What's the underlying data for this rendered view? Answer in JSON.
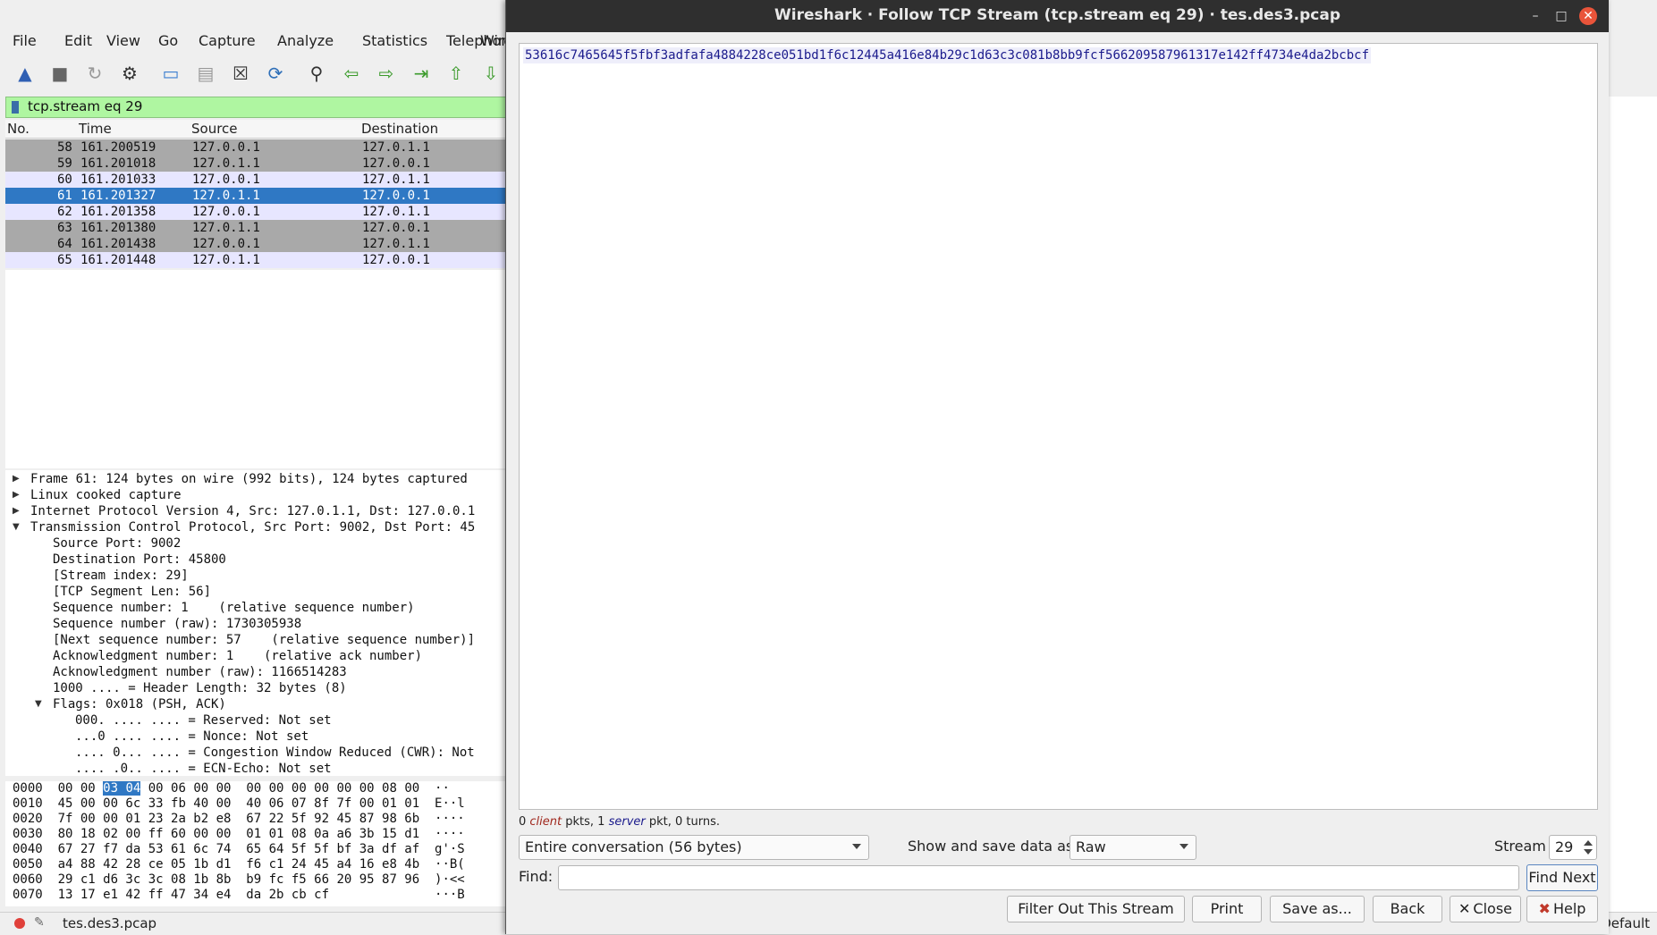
{
  "main": {
    "menu": [
      "File",
      "Edit",
      "View",
      "Go",
      "Capture",
      "Analyze",
      "Statistics",
      "Telephony",
      "Wirele"
    ],
    "filter": "tcp.stream eq 29",
    "columns": [
      "No.",
      "Time",
      "Source",
      "Destination"
    ],
    "packets": [
      {
        "no": "58",
        "time": "161.200519",
        "src": "127.0.0.1",
        "dst": "127.0.1.1"
      },
      {
        "no": "59",
        "time": "161.201018",
        "src": "127.0.1.1",
        "dst": "127.0.0.1"
      },
      {
        "no": "60",
        "time": "161.201033",
        "src": "127.0.0.1",
        "dst": "127.0.1.1"
      },
      {
        "no": "61",
        "time": "161.201327",
        "src": "127.0.1.1",
        "dst": "127.0.0.1"
      },
      {
        "no": "62",
        "time": "161.201358",
        "src": "127.0.0.1",
        "dst": "127.0.1.1"
      },
      {
        "no": "63",
        "time": "161.201380",
        "src": "127.0.1.1",
        "dst": "127.0.0.1"
      },
      {
        "no": "64",
        "time": "161.201438",
        "src": "127.0.0.1",
        "dst": "127.0.1.1"
      },
      {
        "no": "65",
        "time": "161.201448",
        "src": "127.0.1.1",
        "dst": "127.0.0.1"
      }
    ],
    "details": [
      "Frame 61: 124 bytes on wire (992 bits), 124 bytes captured",
      "Linux cooked capture",
      "Internet Protocol Version 4, Src: 127.0.1.1, Dst: 127.0.0.1",
      "Transmission Control Protocol, Src Port: 9002, Dst Port: 45",
      "Source Port: 9002",
      "Destination Port: 45800",
      "[Stream index: 29]",
      "[TCP Segment Len: 56]",
      "Sequence number: 1    (relative sequence number)",
      "Sequence number (raw): 1730305938",
      "[Next sequence number: 57    (relative sequence number)]",
      "Acknowledgment number: 1    (relative ack number)",
      "Acknowledgment number (raw): 1166514283",
      "1000 .... = Header Length: 32 bytes (8)",
      "Flags: 0x018 (PSH, ACK)",
      "000. .... .... = Reserved: Not set",
      "...0 .... .... = Nonce: Not set",
      ".... 0... .... = Congestion Window Reduced (CWR): Not",
      ".... .0.. .... = ECN-Echo: Not set"
    ],
    "bytes": [
      {
        "off": "0000",
        "pre": "00 00 ",
        "hl": "03 04",
        "post": " 00 06 00 00  00 00 00 00 00 00 08 00",
        "ascii": "  ··"
      },
      {
        "off": "0010",
        "pre": "45 00 00 6c 33 fb 40 00  40 06 07 8f 7f 00 01 01",
        "hl": "",
        "post": "",
        "ascii": "  E··l"
      },
      {
        "off": "0020",
        "pre": "7f 00 00 01 23 2a b2 e8  67 22 5f 92 45 87 98 6b",
        "hl": "",
        "post": "",
        "ascii": "  ····"
      },
      {
        "off": "0030",
        "pre": "80 18 02 00 ff 60 00 00  01 01 08 0a a6 3b 15 d1",
        "hl": "",
        "post": "",
        "ascii": "  ····"
      },
      {
        "off": "0040",
        "pre": "67 27 f7 da 53 61 6c 74  65 64 5f 5f bf 3a df af",
        "hl": "",
        "post": "",
        "ascii": "  g'·S"
      },
      {
        "off": "0050",
        "pre": "a4 88 42 28 ce 05 1b d1  f6 c1 24 45 a4 16 e8 4b",
        "hl": "",
        "post": "",
        "ascii": "  ··B("
      },
      {
        "off": "0060",
        "pre": "29 c1 d6 3c 3c 08 1b 8b  b9 fc f5 66 20 95 87 96",
        "hl": "",
        "post": "",
        "ascii": "  )·<<"
      },
      {
        "off": "0070",
        "pre": "13 17 e1 42 ff 47 34 e4  da 2b cb cf",
        "hl": "",
        "post": "",
        "ascii": "              ···B"
      }
    ],
    "status_file": "tes.des3.pcap",
    "status_profile": "Default"
  },
  "dialog": {
    "title": "Wireshark · Follow TCP Stream (tcp.stream eq 29) · tes.des3.pcap",
    "stream_text": "53616c7465645f5fbf3adfafa4884228ce051bd1f6c12445a416e84b29c1d63c3c081b8bb9fcf566209587961317e142ff4734e4da2bcbcf",
    "summary_pre": "0 ",
    "summary_client": "client",
    "summary_mid": " pkts, 1 ",
    "summary_server": "server",
    "summary_post": " pkt, 0 turns.",
    "conversation": "Entire conversation (56 bytes)",
    "show_label": "Show and save data as",
    "show_format": "Raw",
    "stream_label": "Stream",
    "stream_value": "29",
    "find_label": "Find:",
    "find_value": "",
    "find_next": "Find Next",
    "buttons": {
      "filter_out": "Filter Out This Stream",
      "print": "Print",
      "save_as": "Save as...",
      "back": "Back",
      "close": "Close",
      "help": "Help"
    }
  }
}
